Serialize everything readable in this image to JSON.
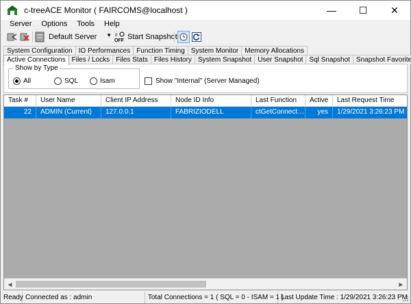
{
  "window": {
    "title": "c-treeACE Monitor ( FAIRCOMS@localhost )",
    "minimize_glyph": "—",
    "maximize_glyph": "☐",
    "close_glyph": "✕"
  },
  "menu": {
    "items": [
      {
        "label": "Server"
      },
      {
        "label": "Options"
      },
      {
        "label": "Tools"
      },
      {
        "label": "Help"
      }
    ]
  },
  "toolbar": {
    "server_combo_value": "Default Server",
    "start_snapshots_label": "Start Snapshots"
  },
  "tabs": {
    "row1": [
      "System Configuration",
      "IO Performances",
      "Function Timing",
      "System Monitor",
      "Memory Allocations"
    ],
    "row2": [
      "Active Connections",
      "Files / Locks",
      "Files Stats",
      "Files History",
      "System Snapshot",
      "User Snapshot",
      "Sql Snapshot",
      "Snapshot Favorites"
    ],
    "active": "Active Connections"
  },
  "filter": {
    "group_title": "Show by Type",
    "options": [
      "All",
      "SQL",
      "Isam"
    ],
    "selected": "All",
    "internal_label": "Show \"Internal\" (Server Managed)",
    "internal_checked": false
  },
  "grid": {
    "columns": [
      "Task #",
      "User Name",
      "Client IP Address",
      "Node ID Info",
      "Last Function",
      "Active",
      "Last Request Time"
    ],
    "rows": [
      {
        "task": "22",
        "user": "ADMIN (Current)",
        "ip": "127.0.0.1",
        "node": "FABRIZIODELL",
        "last_function": "ctGetConnectionI...",
        "active": "yes",
        "last_request": "1/29/2021 3:26:23 PM"
      }
    ]
  },
  "status": {
    "ready": "Ready",
    "connected": "Connected as : admin",
    "totals": "Total Connections = 1 ( SQL = 0 - ISAM = 1 )",
    "last_update": "Last Update Time : 1/29/2021 3:26:23 PM"
  },
  "colors": {
    "selection": "#0078d7",
    "grid_background": "#ababab"
  }
}
